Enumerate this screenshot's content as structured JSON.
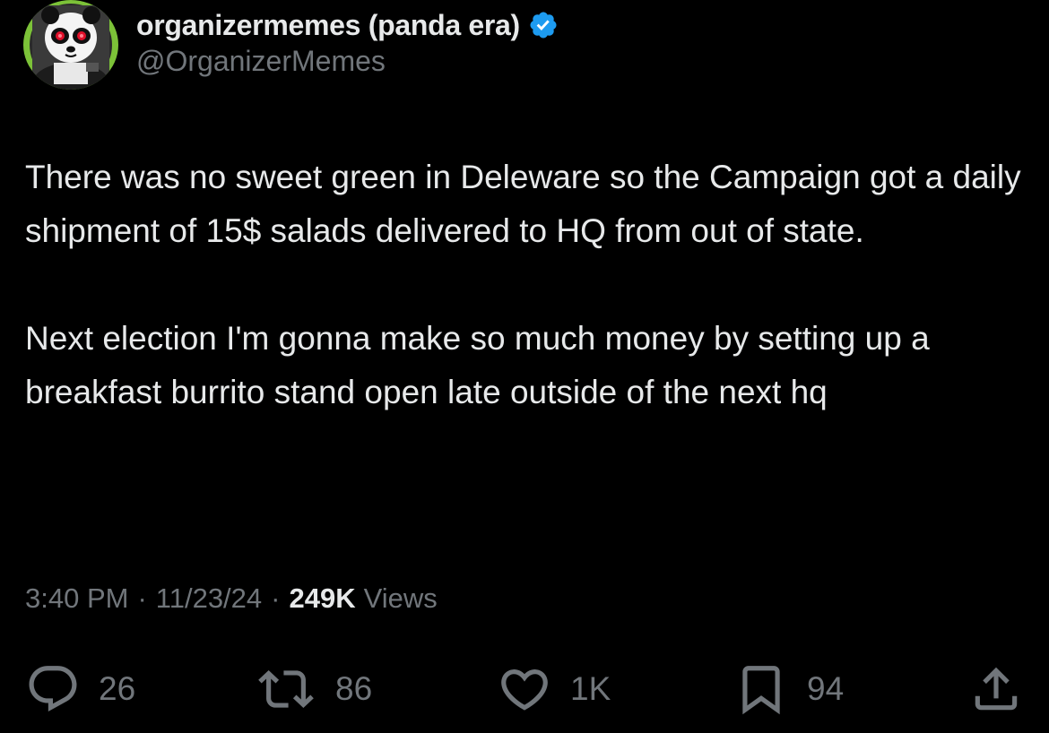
{
  "author": {
    "display_name": "organizermemes (panda era)",
    "handle": "@OrganizerMemes",
    "verified": true,
    "avatar_ring_color": "#7cc238",
    "verified_color": "#1d9bf0"
  },
  "tweet": {
    "paragraphs": [
      "There was no sweet green in Deleware so the Campaign got a daily shipment of 15$ salads delivered to HQ from out of state.",
      "Next election I'm gonna make so much money by setting up a breakfast burrito stand open late outside of the next hq"
    ]
  },
  "meta": {
    "time": "3:40 PM",
    "separator": "·",
    "date": "11/23/24",
    "views_count": "249K",
    "views_label": "Views"
  },
  "actions": {
    "replies": {
      "icon": "reply-icon",
      "count": "26"
    },
    "reposts": {
      "icon": "repost-icon",
      "count": "86"
    },
    "likes": {
      "icon": "heart-icon",
      "count": "1K"
    },
    "bookmarks": {
      "icon": "bookmark-icon",
      "count": "94"
    },
    "share": {
      "icon": "share-icon"
    }
  }
}
